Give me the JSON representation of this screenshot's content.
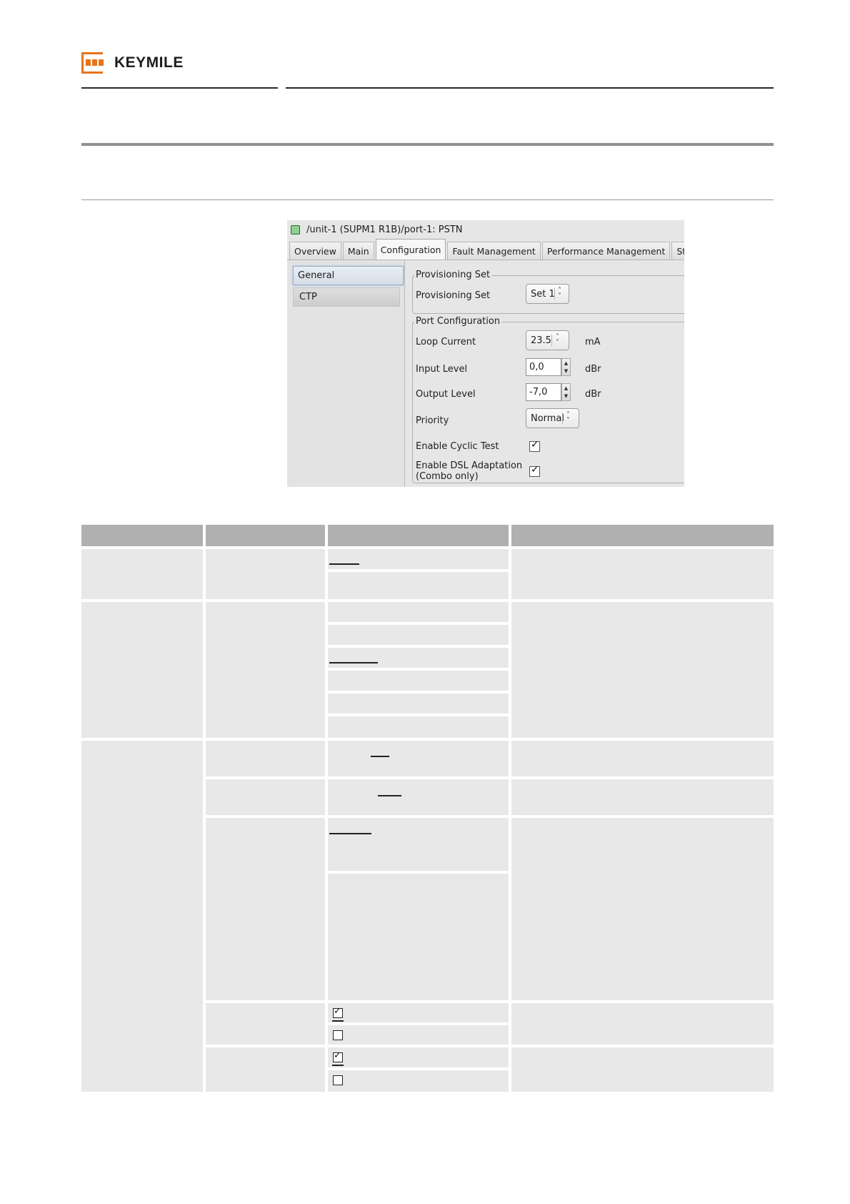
{
  "header": {
    "brand": "KEYMILE",
    "logo_icon": "keymile-logo-icon",
    "brand_color": "#e8731c"
  },
  "screenshot": {
    "title": "/unit-1 (SUPM1 R1B)/port-1: PSTN",
    "status_color": "#8fd08f",
    "tabs": [
      "Overview",
      "Main",
      "Configuration",
      "Fault Management",
      "Performance Management",
      "Status"
    ],
    "active_tab": "Configuration",
    "sidebar": [
      "General",
      "CTP"
    ],
    "provisioning_group": {
      "legend": "Provisioning Set",
      "label": "Provisioning Set",
      "value": "Set 1"
    },
    "port_group": {
      "legend": "Port Configuration",
      "loop_current": {
        "label": "Loop Current",
        "value": "23.5",
        "unit": "mA"
      },
      "input_level": {
        "label": "Input Level",
        "value": "0,0",
        "unit": "dBr"
      },
      "output_level": {
        "label": "Output Level",
        "value": "-7,0",
        "unit": "dBr"
      },
      "priority": {
        "label": "Priority",
        "value": "Normal"
      },
      "cyclic_test": {
        "label": "Enable Cyclic Test",
        "checked": true
      },
      "dsl_adaptation": {
        "label_line1": "Enable DSL Adaptation",
        "label_line2": "(Combo only)",
        "checked": true
      }
    }
  },
  "table": {
    "checkbox_rows": [
      {
        "checked": true
      },
      {
        "checked": false
      },
      {
        "checked": true
      },
      {
        "checked": false
      }
    ]
  }
}
